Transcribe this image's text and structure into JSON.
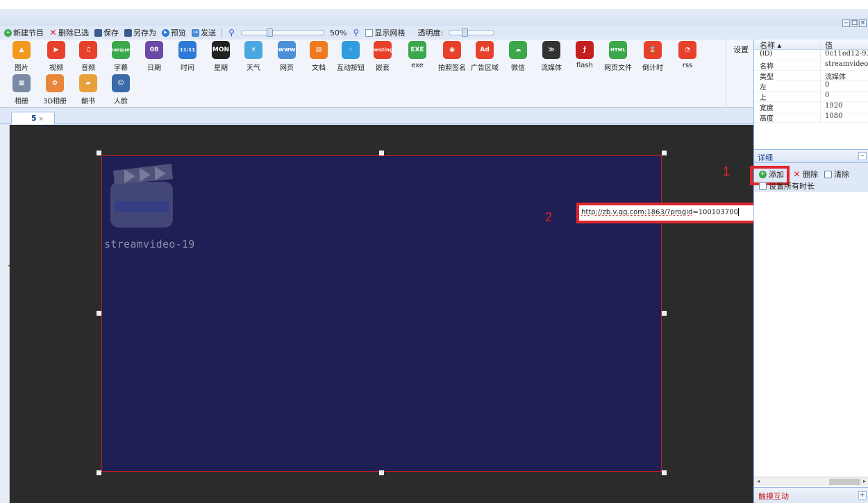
{
  "toolbar": {
    "new_program": "新建节目",
    "delete_selected": "删除已选",
    "save": "保存",
    "save_as": "另存为",
    "preview": "预览",
    "send": "发送",
    "zoom": "50%",
    "show_grid": "显示网格",
    "opacity": "透明度:"
  },
  "palette": {
    "items": [
      {
        "label": "图片",
        "icon": "picture-icon",
        "color": "#f39a1e",
        "glyph": "▲"
      },
      {
        "label": "视频",
        "icon": "video-icon",
        "color": "#e8412b",
        "glyph": "▶"
      },
      {
        "label": "音频",
        "icon": "audio-icon",
        "color": "#e8412b",
        "glyph": "♫"
      },
      {
        "label": "字幕",
        "icon": "marquee-icon",
        "color": "#3aa84b",
        "glyph": "marquee"
      },
      {
        "label": "日期",
        "icon": "date-icon",
        "color": "#6a4aa8",
        "glyph": "08"
      },
      {
        "label": "时间",
        "icon": "time-icon",
        "color": "#2f7ad6",
        "glyph": "11:11"
      },
      {
        "label": "星期",
        "icon": "week-icon",
        "color": "#222222",
        "glyph": "MON"
      },
      {
        "label": "天气",
        "icon": "weather-icon",
        "color": "#4aa8e0",
        "glyph": "☀"
      },
      {
        "label": "网页",
        "icon": "webpage-icon",
        "color": "#4d8fd6",
        "glyph": "www"
      },
      {
        "label": "文档",
        "icon": "document-icon",
        "color": "#f07a1e",
        "glyph": "▤"
      },
      {
        "label": "互动按钮",
        "icon": "interactive-button-icon",
        "color": "#2f9ce0",
        "glyph": "☝"
      },
      {
        "label": "嵌套",
        "icon": "nesting-icon",
        "color": "#e8412b",
        "glyph": "nesting"
      },
      {
        "label": "exe",
        "icon": "exe-icon",
        "color": "#3aa84b",
        "glyph": "EXE"
      },
      {
        "label": "拍照签名",
        "icon": "photo-signature-icon",
        "color": "#e8412b",
        "glyph": "◉"
      },
      {
        "label": "广告区域",
        "icon": "ad-area-icon",
        "color": "#e8412b",
        "glyph": "Ad"
      },
      {
        "label": "微信",
        "icon": "wechat-icon",
        "color": "#3aa84b",
        "glyph": "☁"
      },
      {
        "label": "流媒体",
        "icon": "streaming-icon",
        "color": "#333333",
        "glyph": "≫"
      },
      {
        "label": "flash",
        "icon": "flash-icon",
        "color": "#c41e1e",
        "glyph": "ƒ"
      },
      {
        "label": "网页文件",
        "icon": "html-file-icon",
        "color": "#3aa84b",
        "glyph": "HTML"
      },
      {
        "label": "倒计时",
        "icon": "countdown-icon",
        "color": "#e8412b",
        "glyph": "⌛"
      },
      {
        "label": "rss",
        "icon": "rss-icon",
        "color": "#e8412b",
        "glyph": "◔"
      },
      {
        "label": "相册",
        "icon": "album-icon",
        "color": "#7a8aa6",
        "glyph": "▦"
      },
      {
        "label": "3D相册",
        "icon": "3d-album-icon",
        "color": "#e8863a",
        "glyph": "✿"
      },
      {
        "label": "翻书",
        "icon": "flip-book-icon",
        "color": "#e8a03a",
        "glyph": "▰"
      },
      {
        "label": "人脸",
        "icon": "face-icon",
        "color": "#3a6aa8",
        "glyph": "☺"
      }
    ],
    "settings": "设置"
  },
  "tab": {
    "label": "5",
    "close": "×"
  },
  "canvas": {
    "element_label": "streamvideo-19"
  },
  "annotations": {
    "marker1": "1",
    "marker2": "2"
  },
  "url_field": {
    "part1": "http://zb.v.qq.com:1863/?",
    "part2": "progid",
    "part3": "=100103700"
  },
  "properties": {
    "header_name": "名称 ▴",
    "header_value": "值",
    "rows": [
      {
        "name": "(ID)",
        "value": "0c11ed12-9..."
      },
      {
        "name": "名称",
        "value": "streamvideo..."
      },
      {
        "name": "类型",
        "value": "流媒体"
      },
      {
        "name": "左",
        "value": "0"
      },
      {
        "name": "上",
        "value": "0"
      },
      {
        "name": "宽度",
        "value": "1920"
      },
      {
        "name": "高度",
        "value": "1080"
      }
    ]
  },
  "details": {
    "title": "详细",
    "add": "添加",
    "delete": "删除",
    "clear": "清除",
    "set_all_duration": "设置所有时长"
  },
  "touch": {
    "title": "触摸互动"
  }
}
